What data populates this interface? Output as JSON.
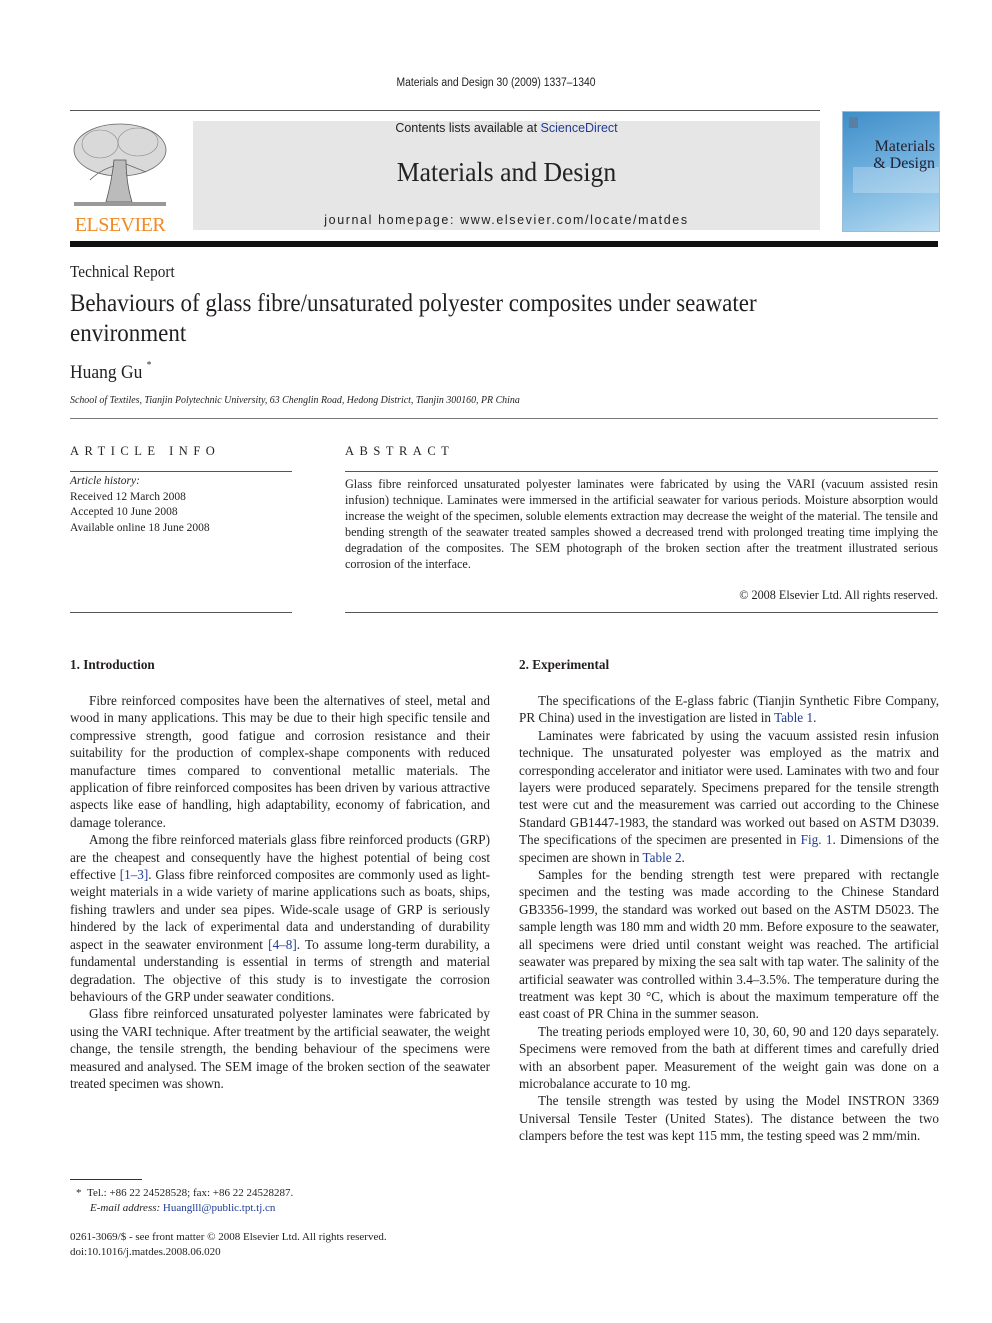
{
  "running_head": "Materials and Design 30 (2009) 1337–1340",
  "masthead": {
    "publisher_logo": "ELSEVIER",
    "contents_prefix": "Contents lists available at ",
    "contents_link": "ScienceDirect",
    "journal_title": "Materials and Design",
    "homepage": "journal homepage: www.elsevier.com/locate/matdes",
    "cover_title_line1": "Materials",
    "cover_title_line2": "& Design",
    "brand_color": "#f08a24",
    "link_color": "#1f3a93"
  },
  "article": {
    "type": "Technical Report",
    "title": "Behaviours of glass fibre/unsaturated polyester composites under seawater environment",
    "author": "Huang Gu",
    "author_mark": "*",
    "affiliation": "School of Textiles, Tianjin Polytechnic University, 63 Chenglin Road, Hedong District, Tianjin 300160, PR China"
  },
  "article_info": {
    "heading": "ARTICLE INFO",
    "history_label": "Article history:",
    "received": "Received 12 March 2008",
    "accepted": "Accepted 10 June 2008",
    "online": "Available online 18 June 2008"
  },
  "abstract": {
    "heading": "ABSTRACT",
    "text": "Glass fibre reinforced unsaturated polyester laminates were fabricated by using the VARI (vacuum assisted resin infusion) technique. Laminates were immersed in the artificial seawater for various periods. Moisture absorption would increase the weight of the specimen, soluble elements extraction may decrease the weight of the material. The tensile and bending strength of the seawater treated samples showed a decreased trend with prolonged treating time implying the degradation of the composites. The SEM photograph of the broken section after the treatment illustrated serious corrosion of the interface.",
    "copyright": "© 2008 Elsevier Ltd. All rights reserved."
  },
  "introduction": {
    "heading": "1. Introduction",
    "p1": "Fibre reinforced composites have been the alternatives of steel, metal and wood in many applications. This may be due to their high specific tensile and compressive strength, good fatigue and corrosion resistance and their suitability for the production of complex-shape components with reduced manufacture times compared to conventional metallic materials. The application of fibre reinforced composites has been driven by various attractive aspects like ease of handling, high adaptability, economy of fabrication, and damage tolerance.",
    "p2_a": "Among the fibre reinforced materials glass fibre reinforced products (GRP) are the cheapest and consequently have the highest potential of being cost effective ",
    "p2_ref1": "[1–3]",
    "p2_b": ". Glass fibre reinforced composites are commonly used as light-weight materials in a wide variety of marine applications such as boats, ships, fishing trawlers and under sea pipes. Wide-scale usage of GRP is seriously hindered by the lack of experimental data and understanding of durability aspect in the seawater environment ",
    "p2_ref2": "[4–8]",
    "p2_c": ". To assume long-term durability, a fundamental understanding is essential in terms of strength and material degradation. The objective of this study is to investigate the corrosion behaviours of the GRP under seawater conditions.",
    "p3": "Glass fibre reinforced unsaturated polyester laminates were fabricated by using the VARI technique. After treatment by the artificial seawater, the weight change, the tensile strength, the bending behaviour of the specimens were measured and analysed. The SEM image of the broken section of the seawater treated specimen was shown."
  },
  "experimental": {
    "heading": "2. Experimental",
    "p1_a": "The specifications of the E-glass fabric (Tianjin Synthetic Fibre Company, PR China) used in the investigation are listed in ",
    "p1_ref": "Table 1",
    "p1_b": ".",
    "p2_a": "Laminates were fabricated by using the vacuum assisted resin infusion technique. The unsaturated polyester was employed as the matrix and corresponding accelerator and initiator were used. Laminates with two and four layers were produced separately. Specimens prepared for the tensile strength test were cut and the measurement was carried out according to the Chinese Standard GB1447-1983, the standard was worked out based on ASTM D3039. The specifications of the specimen are presented in ",
    "p2_ref1": "Fig. 1",
    "p2_b": ". Dimensions of the specimen are shown in ",
    "p2_ref2": "Table 2",
    "p2_c": ".",
    "p3": "Samples for the bending strength test were prepared with rectangle specimen and the testing was made according to the Chinese Standard GB3356-1999, the standard was worked out based on the ASTM D5023. The sample length was 180 mm and width 20 mm. Before exposure to the seawater, all specimens were dried until constant weight was reached. The artificial seawater was prepared by mixing the sea salt with tap water. The salinity of the artificial seawater was controlled within 3.4–3.5%. The temperature during the treatment was kept 30 °C, which is about the maximum temperature off the east coast of PR China in the summer season.",
    "p4": "The treating periods employed were 10, 30, 60, 90 and 120 days separately. Specimens were removed from the bath at different times and carefully dried with an absorbent paper. Measurement of the weight gain was done on a microbalance accurate to 10 mg.",
    "p5": "The tensile strength was tested by using the Model INSTRON 3369 Universal Tensile Tester (United States). The distance between the two clampers before the test was kept 115 mm, the testing speed was 2 mm/min."
  },
  "footnote": {
    "mark": "*",
    "contact": "Tel.: +86 22 24528528; fax: +86 22 24528287.",
    "email_label": "E-mail address: ",
    "email": "Huanglll@public.tpt.tj.cn"
  },
  "front_matter": {
    "issn_line": "0261-3069/$ - see front matter © 2008 Elsevier Ltd. All rights reserved.",
    "doi": "doi:10.1016/j.matdes.2008.06.020"
  }
}
